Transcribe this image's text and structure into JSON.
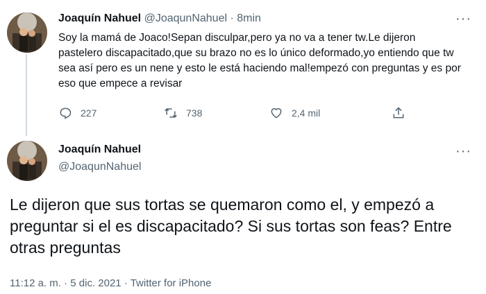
{
  "tweet1": {
    "author_name": "Joaquín Nahuel",
    "handle": "@JoaqunNahuel",
    "separator": "·",
    "time_ago": "8min",
    "text": "Soy la mamá de Joaco!Sepan disculpar,pero ya no va a tener tw.Le dijeron pastelero discapacitado,que su brazo no es lo único deformado,yo entiendo que tw sea así pero es un nene y esto le está haciendo mal!empezó con preguntas y es por eso que empece a revisar",
    "replies": "227",
    "retweets": "738",
    "likes": "2,4 mil"
  },
  "tweet2": {
    "author_name": "Joaquín Nahuel",
    "handle": "@JoaqunNahuel",
    "text": "Le dijeron que sus tortas se quemaron como el, y empezó a preguntar si el es discapacitado? Si sus tortas son feas? Entre otras preguntas",
    "timestamp": "11:12 a. m. · 5 dic. 2021 · Twitter for iPhone"
  },
  "icons": {
    "reply": "reply-icon",
    "retweet": "retweet-icon",
    "like": "heart-icon",
    "share": "share-icon",
    "more": "more-icon"
  },
  "colors": {
    "text": "#0f1419",
    "muted": "#536471",
    "thread_line": "#cfd9de"
  }
}
